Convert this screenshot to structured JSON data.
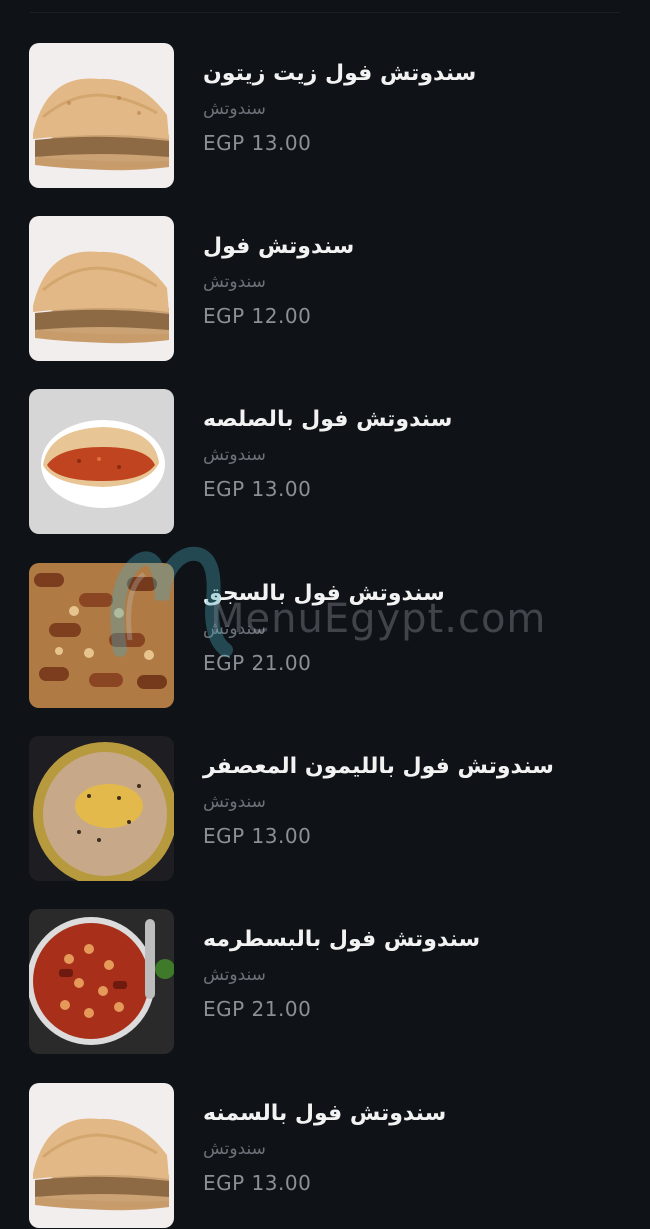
{
  "menu": {
    "items": [
      {
        "title": "سندوتش فول زيت زيتون",
        "category": "سندوتش",
        "price": "EGP 13.00",
        "image": "sandwich-bread-image"
      },
      {
        "title": "سندوتش فول",
        "category": "سندوتش",
        "price": "EGP 12.00",
        "image": "sandwich-bread-image"
      },
      {
        "title": "سندوتش فول بالصلصه",
        "category": "سندوتش",
        "price": "EGP 13.00",
        "image": "sauce-pita-image"
      },
      {
        "title": "سندوتش فول بالسجق",
        "category": "سندوتش",
        "price": "EGP 21.00",
        "image": "sausage-beans-image"
      },
      {
        "title": "سندوتش فول بالليمون المعصفر",
        "category": "سندوتش",
        "price": "EGP 13.00",
        "image": "foul-bowl-image"
      },
      {
        "title": "سندوتش فول بالبسطرمه",
        "category": "سندوتش",
        "price": "EGP 21.00",
        "image": "pastrami-beans-image"
      },
      {
        "title": "سندوتش فول بالسمنه",
        "category": "سندوتش",
        "price": "EGP 13.00",
        "image": "sandwich-bread-image"
      }
    ]
  },
  "watermark": {
    "text": "MenuEgypt.com"
  }
}
